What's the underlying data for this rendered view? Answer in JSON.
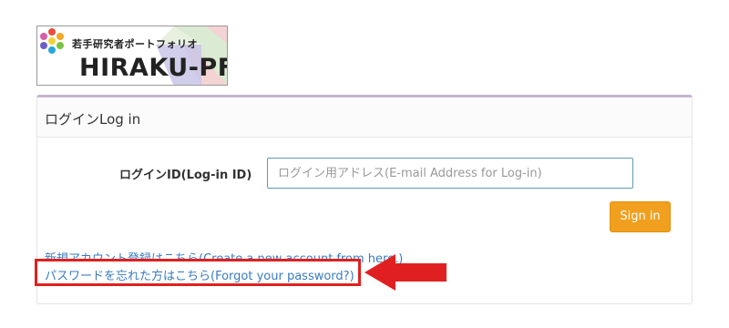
{
  "logo": {
    "subtitle": "若手研究者ポートフォリオ",
    "name": "HIRAKU-PF"
  },
  "panel": {
    "title": "ログインLog in"
  },
  "form": {
    "login_id_label": "ログインID(Log-in ID)",
    "login_id_placeholder": "ログイン用アドレス(E-mail Address for Log-in)",
    "login_id_value": "",
    "signin_label": "Sign in"
  },
  "links": {
    "new_account": "新規アカウント登録はこちら(Create a new account from here.)",
    "forgot_password": "パスワードを忘れた方はこちら(Forgot your password?)"
  },
  "colors": {
    "accent": "#f0a01e",
    "link": "#3a7bbf",
    "highlight": "#e02020",
    "panel_top_border": "#c8b3d1"
  },
  "icons": {
    "logo_mark": "flower-icon",
    "annotation": "arrow-left-icon"
  }
}
